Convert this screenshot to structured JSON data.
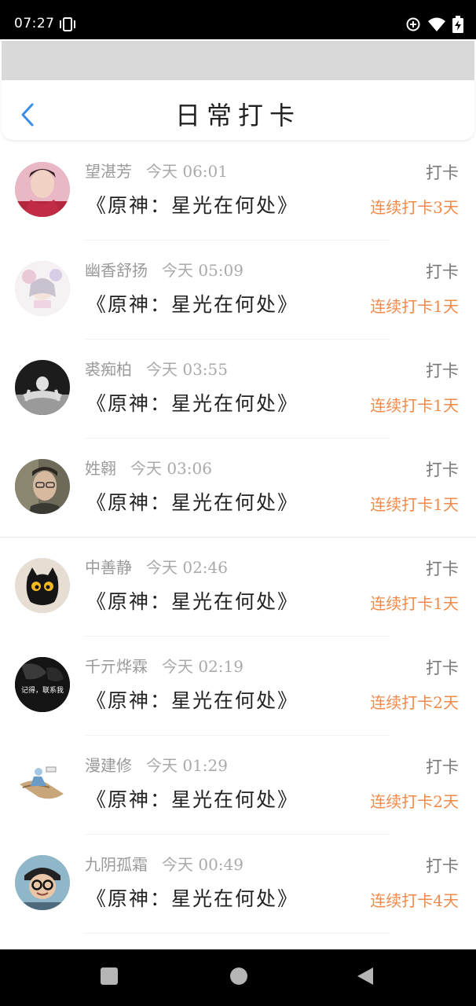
{
  "status_bar": {
    "time": "07:27",
    "icons": [
      "vibrate-icon",
      "data-saver-icon",
      "wifi-icon",
      "battery-charging-icon"
    ]
  },
  "header": {
    "title": "日常打卡",
    "back_icon": "chevron-left-icon",
    "accent": "#3b8ee8"
  },
  "colors": {
    "streak": "#f08a4b",
    "name": "#9a9a9a"
  },
  "entries": [
    {
      "name": "望湛芳",
      "time": "今天 06:01",
      "book": "《原神：星光在何处》",
      "action": "打卡",
      "streak": "连续打卡3天"
    },
    {
      "name": "幽香舒扬",
      "time": "今天 05:09",
      "book": "《原神：星光在何处》",
      "action": "打卡",
      "streak": "连续打卡1天"
    },
    {
      "name": "裘痴柏",
      "time": "今天 03:55",
      "book": "《原神：星光在何处》",
      "action": "打卡",
      "streak": "连续打卡1天"
    },
    {
      "name": "姓翱",
      "time": "今天 03:06",
      "book": "《原神：星光在何处》",
      "action": "打卡",
      "streak": "连续打卡1天"
    },
    {
      "name": "中善静",
      "time": "今天 02:46",
      "book": "《原神：星光在何处》",
      "action": "打卡",
      "streak": "连续打卡1天"
    },
    {
      "name": "千亓烨霖",
      "time": "今天 02:19",
      "book": "《原神：星光在何处》",
      "action": "打卡",
      "streak": "连续打卡2天"
    },
    {
      "name": "漫建修",
      "time": "今天 01:29",
      "book": "《原神：星光在何处》",
      "action": "打卡",
      "streak": "连续打卡2天"
    },
    {
      "name": "九阴孤霜",
      "time": "今天 00:49",
      "book": "《原神：星光在何处》",
      "action": "打卡",
      "streak": "连续打卡4天"
    }
  ],
  "avatar_texts": {
    "entry_6": "记得，联系我"
  },
  "nav_bar": {
    "icons": [
      "recents-square-icon",
      "home-circle-icon",
      "back-triangle-icon"
    ]
  }
}
